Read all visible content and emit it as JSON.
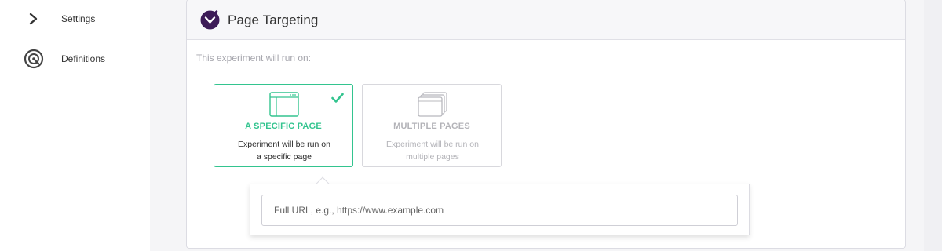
{
  "sidebar": {
    "items": [
      {
        "label": "Settings",
        "icon": "chevron-right-icon"
      },
      {
        "label": "Definitions",
        "icon": "target-icon"
      }
    ]
  },
  "panel": {
    "title": "Page Targeting",
    "logo_icon": "brand-chevron-icon",
    "subtitle": "This experiment will run on:"
  },
  "options": [
    {
      "title": "A SPECIFIC PAGE",
      "description_line1": "Experiment will be run on",
      "description_line2": "a specific page",
      "icon": "single-window-icon",
      "selected": true
    },
    {
      "title": "MULTIPLE PAGES",
      "description_line1": "Experiment will be run on",
      "description_line2": "multiple pages",
      "icon": "stacked-windows-icon",
      "selected": false
    }
  ],
  "url_field": {
    "placeholder": "Full URL, e.g., https://www.example.com",
    "value": ""
  },
  "colors": {
    "accent_green": "#33c48f",
    "brand_purple": "#3d1b57",
    "muted_text": "#a6a6ad"
  }
}
